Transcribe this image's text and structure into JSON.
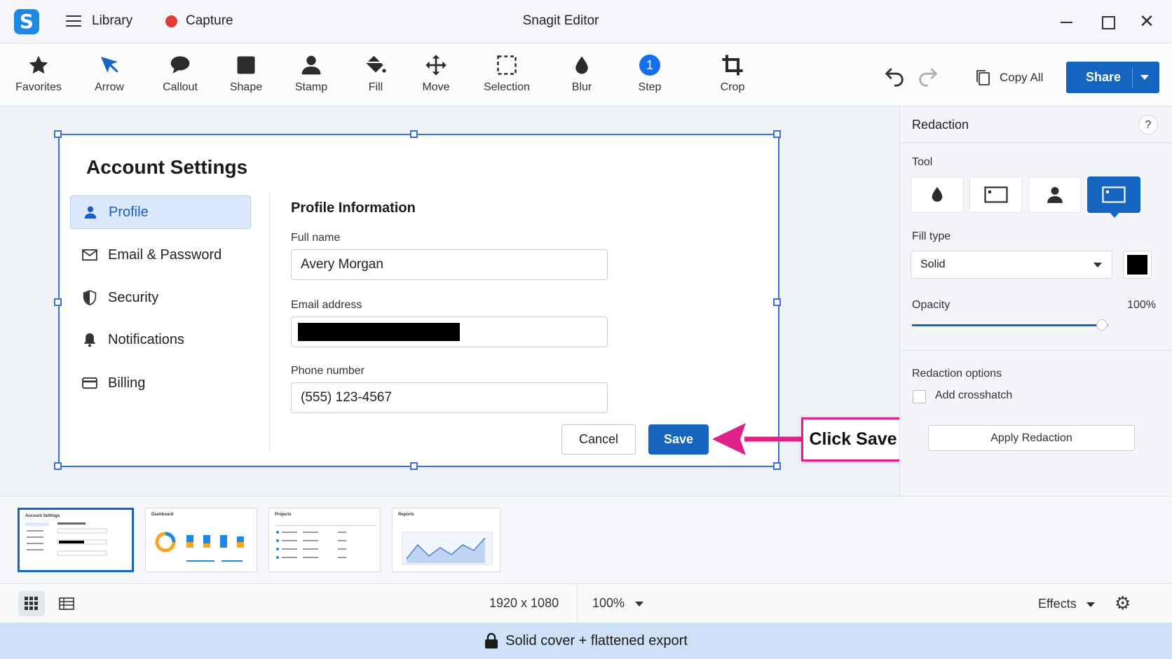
{
  "titlebar": {
    "library_label": "Library",
    "capture_label": "Capture",
    "window_title": "Snagit Editor"
  },
  "toolbar": {
    "tools": [
      {
        "label": "Favorites",
        "icon": "star-icon"
      },
      {
        "label": "Arrow",
        "icon": "arrow-icon"
      },
      {
        "label": "Callout",
        "icon": "speech-bubble-icon"
      },
      {
        "label": "Shape",
        "icon": "square-icon"
      },
      {
        "label": "Stamp",
        "icon": "stamp-person-icon"
      },
      {
        "label": "Fill",
        "icon": "paint-bucket-icon"
      },
      {
        "label": "Move",
        "icon": "move-arrows-icon"
      },
      {
        "label": "Selection",
        "icon": "dashed-selection-icon"
      },
      {
        "label": "Blur",
        "icon": "droplet-icon"
      },
      {
        "label": "Step",
        "icon": "step-number-icon",
        "badge": "1"
      },
      {
        "label": "Crop",
        "icon": "crop-icon"
      }
    ],
    "copy_all_label": "Copy All",
    "share_label": "Share",
    "accent_color": "#1565c0"
  },
  "capture": {
    "title": "Account Settings",
    "nav": [
      {
        "label": "Profile",
        "icon": "person-icon",
        "active": true
      },
      {
        "label": "Email & Password",
        "icon": "envelope-icon"
      },
      {
        "label": "Security",
        "icon": "shield-icon"
      },
      {
        "label": "Notifications",
        "icon": "bell-icon"
      },
      {
        "label": "Billing",
        "icon": "credit-card-icon"
      }
    ],
    "section_title": "Profile Information",
    "fields": {
      "full_name_label": "Full name",
      "full_name_value": "Avery Morgan",
      "email_label": "Email address",
      "email_value": "",
      "phone_label": "Phone number",
      "phone_value": "(555) 123-4567"
    },
    "cancel_label": "Cancel",
    "save_label": "Save",
    "callout_text": "Click Save",
    "callout_color": "#e0218a"
  },
  "panel": {
    "title": "Redaction",
    "help_label": "?",
    "tool_label": "Tool",
    "tool_options": [
      "droplet-icon",
      "rectangle-icon",
      "person-icon",
      "solid-rect-icon"
    ],
    "fill_type_label": "Fill type",
    "fill_type_value": "Solid",
    "fill_color": "#000000",
    "opacity_label": "Opacity",
    "opacity_value": "100%",
    "opacity_fraction": 1.0,
    "options_label": "Redaction options",
    "crosshatch_label": "Add crosshatch",
    "crosshatch_checked": false,
    "apply_label": "Apply Redaction"
  },
  "tray": {
    "thumbnails": [
      {
        "title": "Account Settings",
        "active": true
      },
      {
        "title": "Dashboard"
      },
      {
        "title": "Projects"
      },
      {
        "title": "Reports"
      }
    ]
  },
  "statusbar": {
    "dimensions": "1920 x 1080",
    "zoom": "100%",
    "effects_label": "Effects"
  },
  "banner": {
    "text": "Solid cover + flattened export"
  }
}
